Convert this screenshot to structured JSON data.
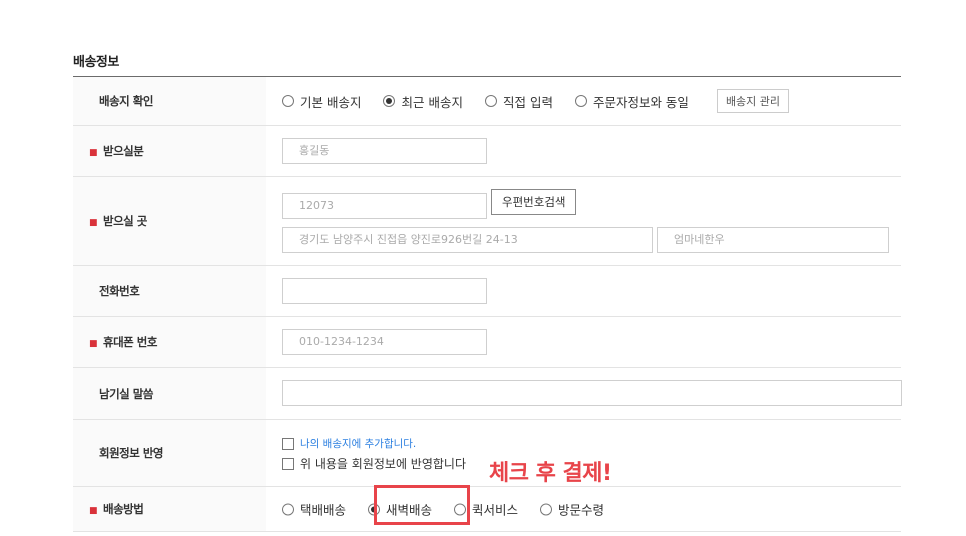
{
  "section": {
    "title": "배송정보"
  },
  "rows": {
    "address_check": {
      "label": "배송지 확인",
      "options": [
        "기본 배송지",
        "최근 배송지",
        "직접 입력",
        "주문자정보와 동일"
      ],
      "selected": "최근 배송지",
      "manage_button": "배송지 관리"
    },
    "recipient": {
      "label": "받으실분",
      "value": "홍길동"
    },
    "address": {
      "label": "받으실 곳",
      "zipcode": "12073",
      "zip_button": "우편번호검색",
      "address1": "경기도 남양주시 진접읍 양진로926번길 24-13",
      "address2": "엄마네한우"
    },
    "phone": {
      "label": "전화번호",
      "value": ""
    },
    "mobile": {
      "label": "휴대폰 번호",
      "value": "010-1234-1234"
    },
    "message": {
      "label": "남기실 말씀",
      "value": ""
    },
    "member_info": {
      "label": "회원정보 반영",
      "check1": "나의 배송지에 추가합니다.",
      "check2": "위 내용을 회원정보에 반영합니다"
    },
    "delivery_method": {
      "label": "배송방법",
      "options": [
        "택배배송",
        "새벽배송",
        "퀵서비스",
        "방문수령"
      ],
      "selected": "새벽배송"
    }
  },
  "annotation": {
    "text": "체크 후 결제!",
    "color": "#e8444a"
  },
  "colors": {
    "required_marker": "#d9323a",
    "link_blue": "#2b7fe0"
  }
}
